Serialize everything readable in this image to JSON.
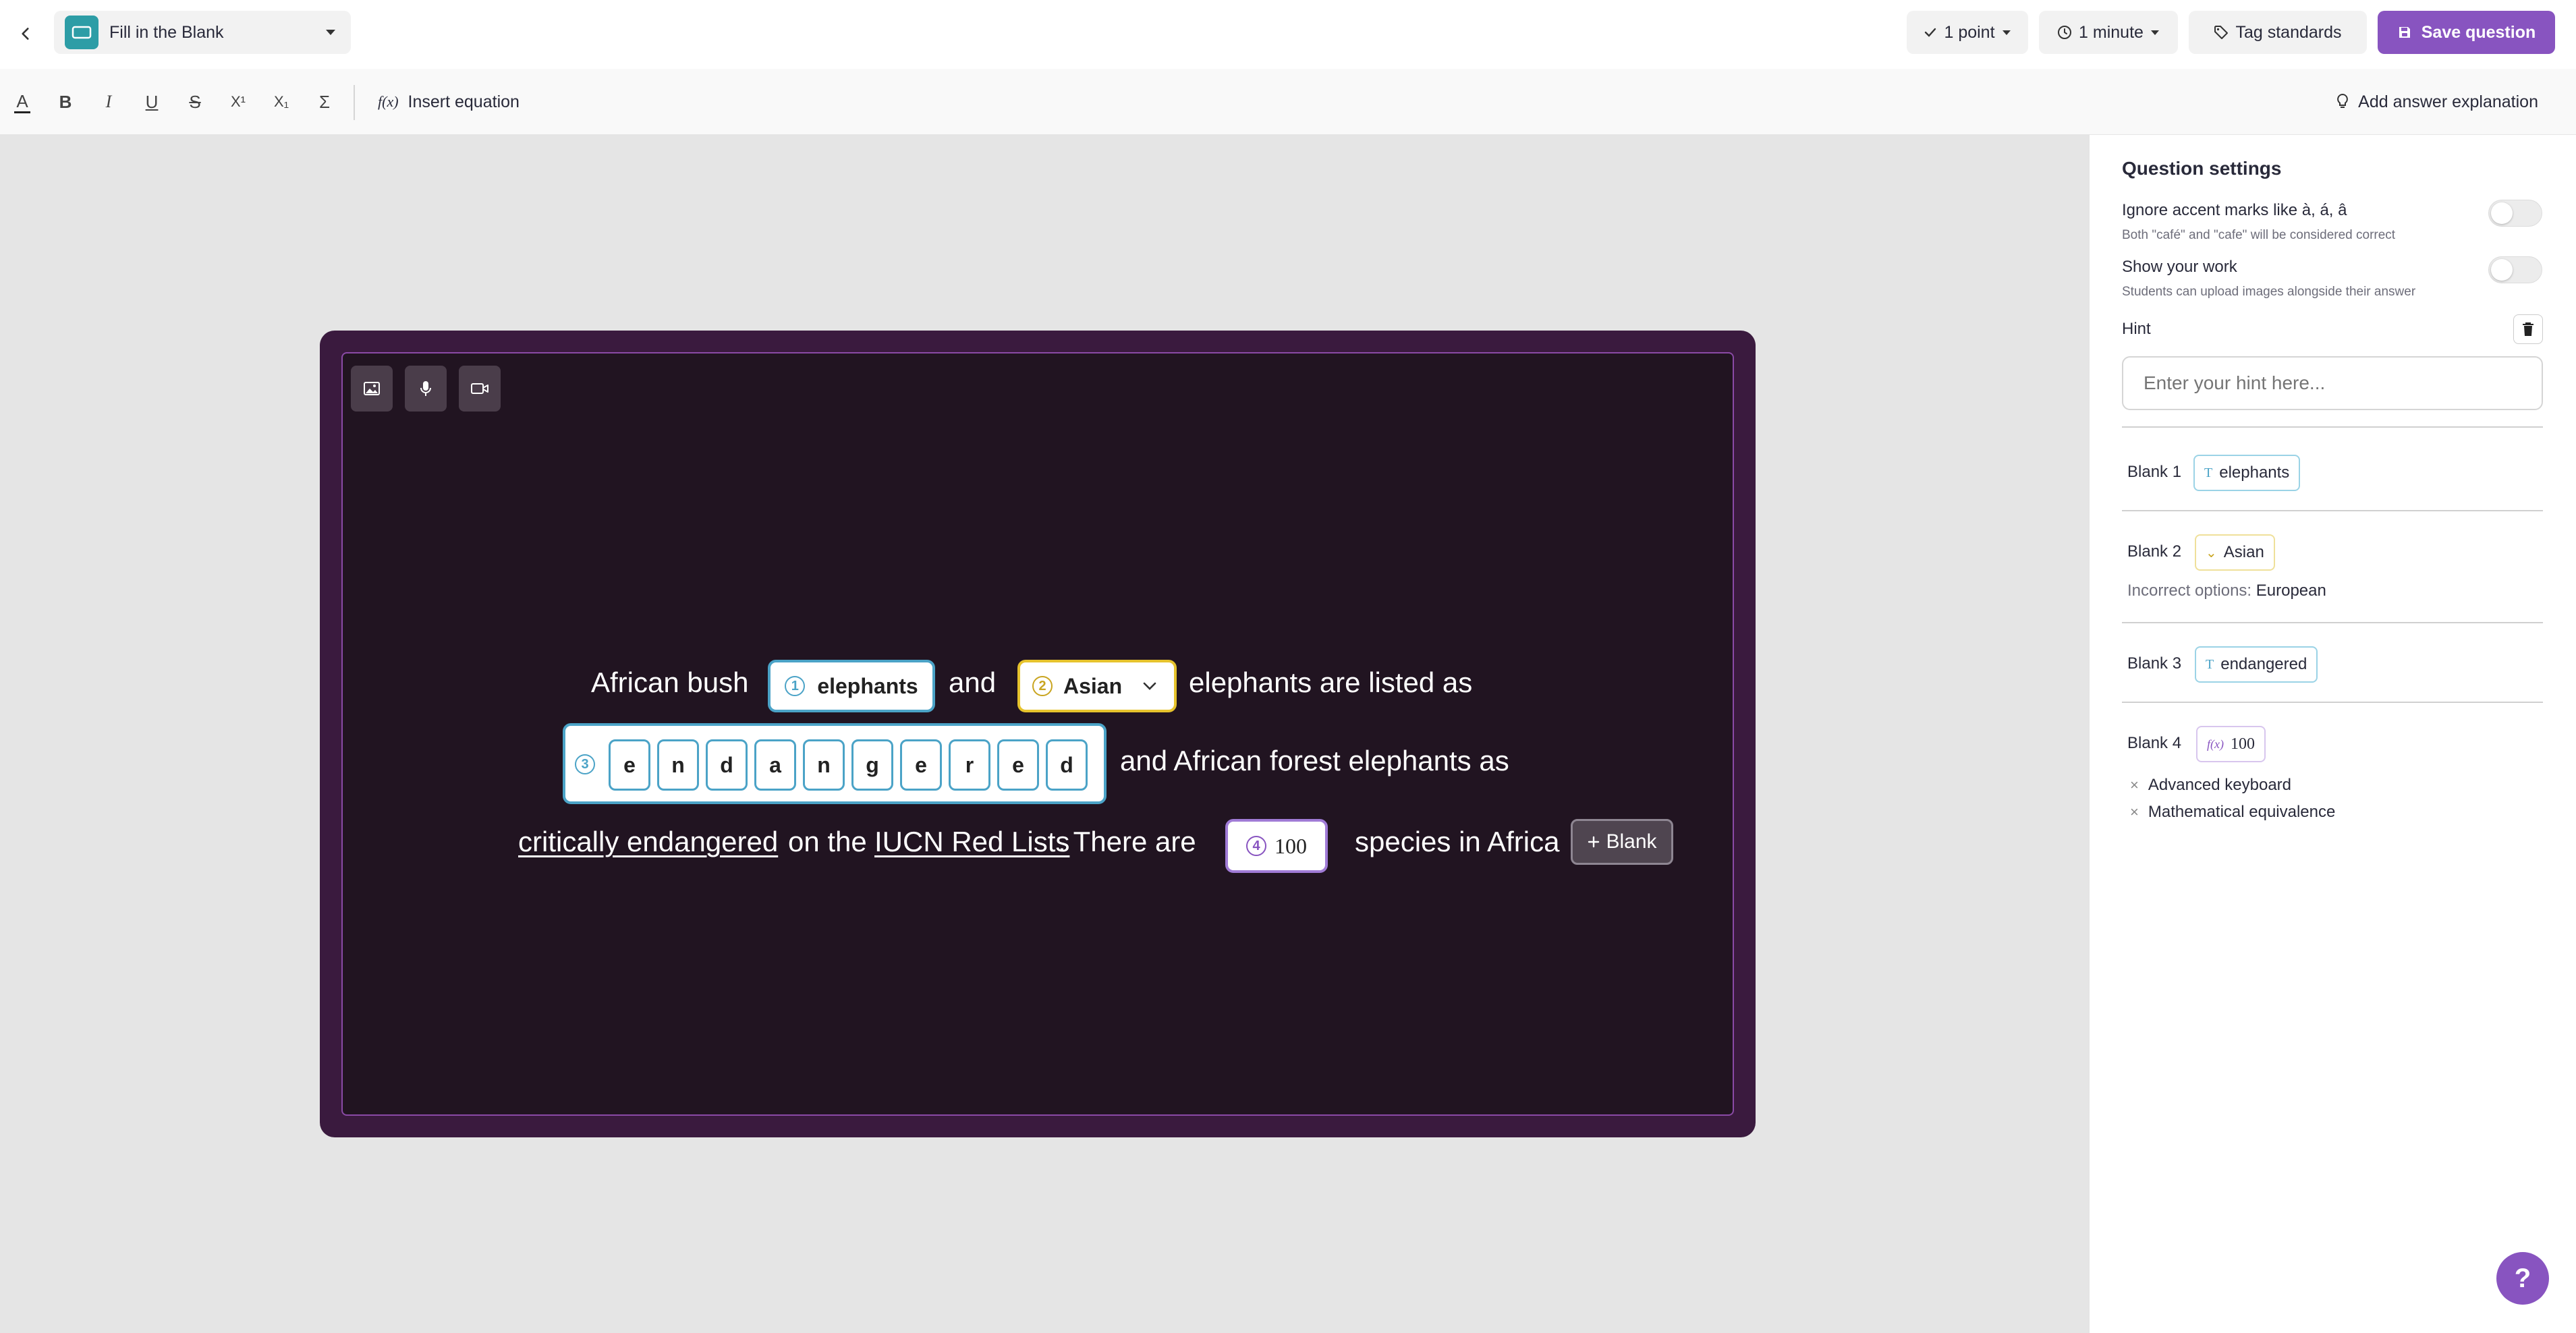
{
  "topbar": {
    "question_type": "Fill in the Blank",
    "points": "1 point",
    "time": "1 minute",
    "tag_standards": "Tag standards",
    "save": "Save question"
  },
  "formatbar": {
    "tools": [
      "text-color",
      "bold",
      "italic",
      "underline",
      "strikethrough",
      "superscript",
      "subscript",
      "sigma"
    ],
    "bold_glyph": "B",
    "italic_glyph": "I",
    "underline_glyph": "U",
    "strike_glyph": "S",
    "superscript_glyph": "X¹",
    "subscript_glyph": "X₁",
    "sigma_glyph": "Σ",
    "text_color_glyph": "A",
    "insert_equation": "Insert equation",
    "add_answer_explanation": "Add answer explanation"
  },
  "question": {
    "line1_a": "African bush",
    "line1_b": "and",
    "line1_c": "elephants are listed as",
    "line2_a": "and African forest elephants as",
    "line3_a": "critically endangered",
    "line3_b": "on the",
    "line3_c": "IUCN Red Lists",
    "line3_d": ".  There are",
    "line3_e": "species in Africa",
    "blank1": {
      "number": "1",
      "answer": "elephants"
    },
    "blank2": {
      "number": "2",
      "answer": "Asian"
    },
    "blank3": {
      "number": "3",
      "letters": [
        "e",
        "n",
        "d",
        "a",
        "n",
        "g",
        "e",
        "r",
        "e",
        "d"
      ]
    },
    "blank4": {
      "number": "4",
      "answer": "100"
    },
    "add_blank": "Blank"
  },
  "panel": {
    "title": "Question settings",
    "accent_label": "Ignore accent marks like à, á, â",
    "accent_sub": "Both \"café\" and \"cafe\" will be considered correct",
    "accent_enabled": false,
    "work_label": "Show your work",
    "work_sub": "Students can upload images alongside their answer",
    "work_enabled": false,
    "hint_label": "Hint",
    "hint_placeholder": "Enter your hint here...",
    "blanks": [
      {
        "label": "Blank 1",
        "answer": "elephants",
        "type_icon": "T"
      },
      {
        "label": "Blank 2",
        "answer": "Asian",
        "type_icon": "⌄",
        "incorrect_label": "Incorrect options:",
        "incorrect_value": "European"
      },
      {
        "label": "Blank 3",
        "answer": "endangered",
        "type_icon": "T"
      },
      {
        "label": "Blank 4",
        "answer": "100",
        "type_icon": "f(x)",
        "features": [
          "Advanced keyboard",
          "Mathematical equivalence"
        ]
      }
    ]
  },
  "help": "?",
  "colors": {
    "brand": "#8854c0",
    "blank_text": "#4ba3c7",
    "blank_dropdown": "#e6c32d",
    "blank_math": "#a07bd6",
    "card_bg": "#3a1a3e"
  }
}
